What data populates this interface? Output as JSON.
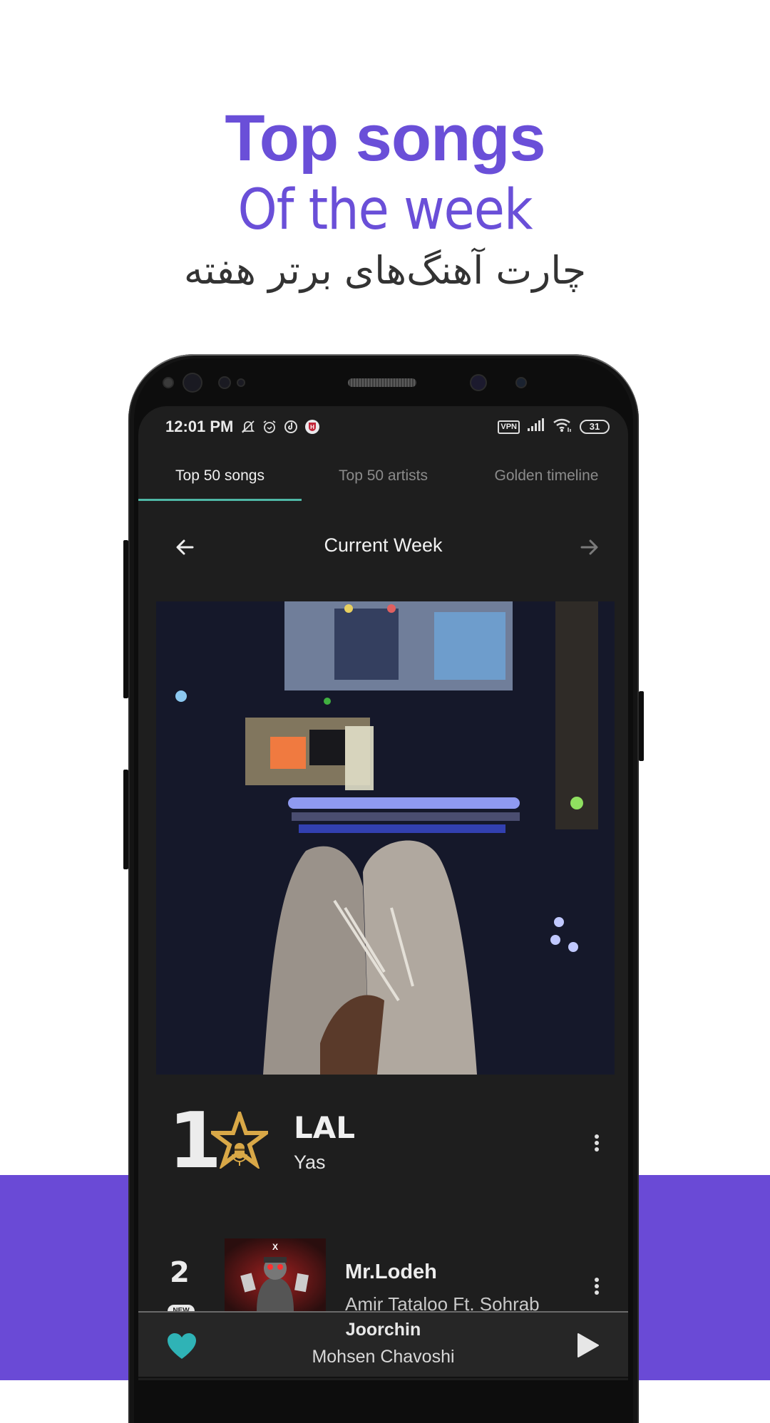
{
  "hero": {
    "title_line1": "Top songs",
    "title_line2": "Of the week",
    "title_persian": "چارت آهنگ‌های برتر هفته",
    "accent_color": "#6a4fd8",
    "band_color": "#6a4ad6"
  },
  "status_bar": {
    "time": "12:01 PM",
    "left_icons": [
      "bell-off-icon",
      "alarm-icon",
      "music-timer-icon",
      "shield-app-icon"
    ],
    "vpn_label": "VPN",
    "battery_level": "31"
  },
  "tabs": [
    {
      "label": "Top 50 songs",
      "active": true
    },
    {
      "label": "Top 50 artists",
      "active": false
    },
    {
      "label": "Golden timeline",
      "active": false
    }
  ],
  "week_nav": {
    "title": "Current Week",
    "prev_icon": "arrow-left-icon",
    "next_icon": "arrow-right-icon"
  },
  "chart": [
    {
      "rank": "1",
      "title": "LAL",
      "artist": "Yas",
      "badge": "star-microphone"
    },
    {
      "rank": "2",
      "title": "Mr.Lodeh",
      "artist": "Amir Tataloo Ft. Sohrab",
      "badge": "NEW"
    }
  ],
  "mini_player": {
    "title": "Joorchin",
    "artist": "Mohsen Chavoshi",
    "liked": true,
    "heart_color": "#2fb3b6"
  }
}
